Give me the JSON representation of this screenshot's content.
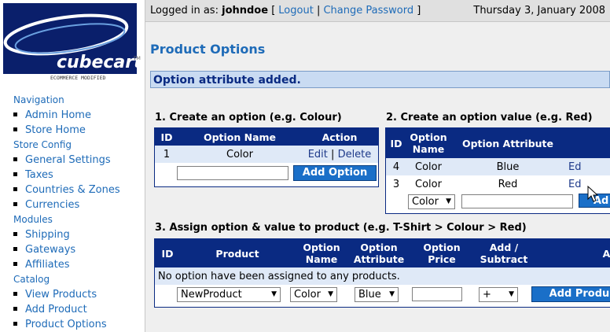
{
  "logo": {
    "brand": "cubecart",
    "tm": "TM",
    "tagline": "ECOMMERCE MODIFIED"
  },
  "topbar": {
    "logged_prefix": "Logged in as:",
    "username": "johndoe",
    "bracket_open": "[",
    "logout": "Logout",
    "sep": "|",
    "change_password": "Change Password",
    "bracket_close": "]",
    "date": "Thursday 3, January 2008"
  },
  "sidebar": {
    "sections": [
      {
        "title": "Navigation",
        "items": [
          "Admin Home",
          "Store Home"
        ]
      },
      {
        "title": "Store Config",
        "items": [
          "General Settings",
          "Taxes",
          "Countries & Zones",
          "Currencies"
        ]
      },
      {
        "title": "Modules",
        "items": [
          "Shipping",
          "Gateways",
          "Affiliates"
        ]
      },
      {
        "title": "Catalog",
        "items": [
          "View Products",
          "Add Product",
          "Product Options"
        ]
      }
    ]
  },
  "main": {
    "page_title": "Product Options",
    "message": "Option attribute added.",
    "section1": {
      "title": "1. Create an option (e.g. Colour)",
      "headers": [
        "ID",
        "Option Name",
        "Action"
      ],
      "row": {
        "id": "1",
        "name": "Color",
        "edit": "Edit",
        "sep": "|",
        "delete": "Delete"
      },
      "add_button": "Add Option",
      "input_value": ""
    },
    "section2": {
      "title": "2. Create an option value (e.g. Red)",
      "headers": [
        "ID",
        "Option Name",
        "Option Attribute"
      ],
      "rows": [
        {
          "id": "4",
          "name": "Color",
          "attribute": "Blue",
          "action": "Ed"
        },
        {
          "id": "3",
          "name": "Color",
          "attribute": "Red",
          "action": "Ed"
        }
      ],
      "select_value": "Color",
      "add_button": "Ad"
    },
    "section3": {
      "title": "3. Assign option & value to product (e.g. T-Shirt > Colour > Red)",
      "headers": [
        "ID",
        "Product",
        "Option Name",
        "Option Attribute",
        "Option Price",
        "Add / Subtract",
        "Acti"
      ],
      "empty_message": "No option have been assigned to any products.",
      "product_select": "NewProduct",
      "option_select": "Color",
      "attribute_select": "Blue",
      "price_value": "",
      "add_subtract_select": "+",
      "add_button": "Add Produ"
    }
  }
}
